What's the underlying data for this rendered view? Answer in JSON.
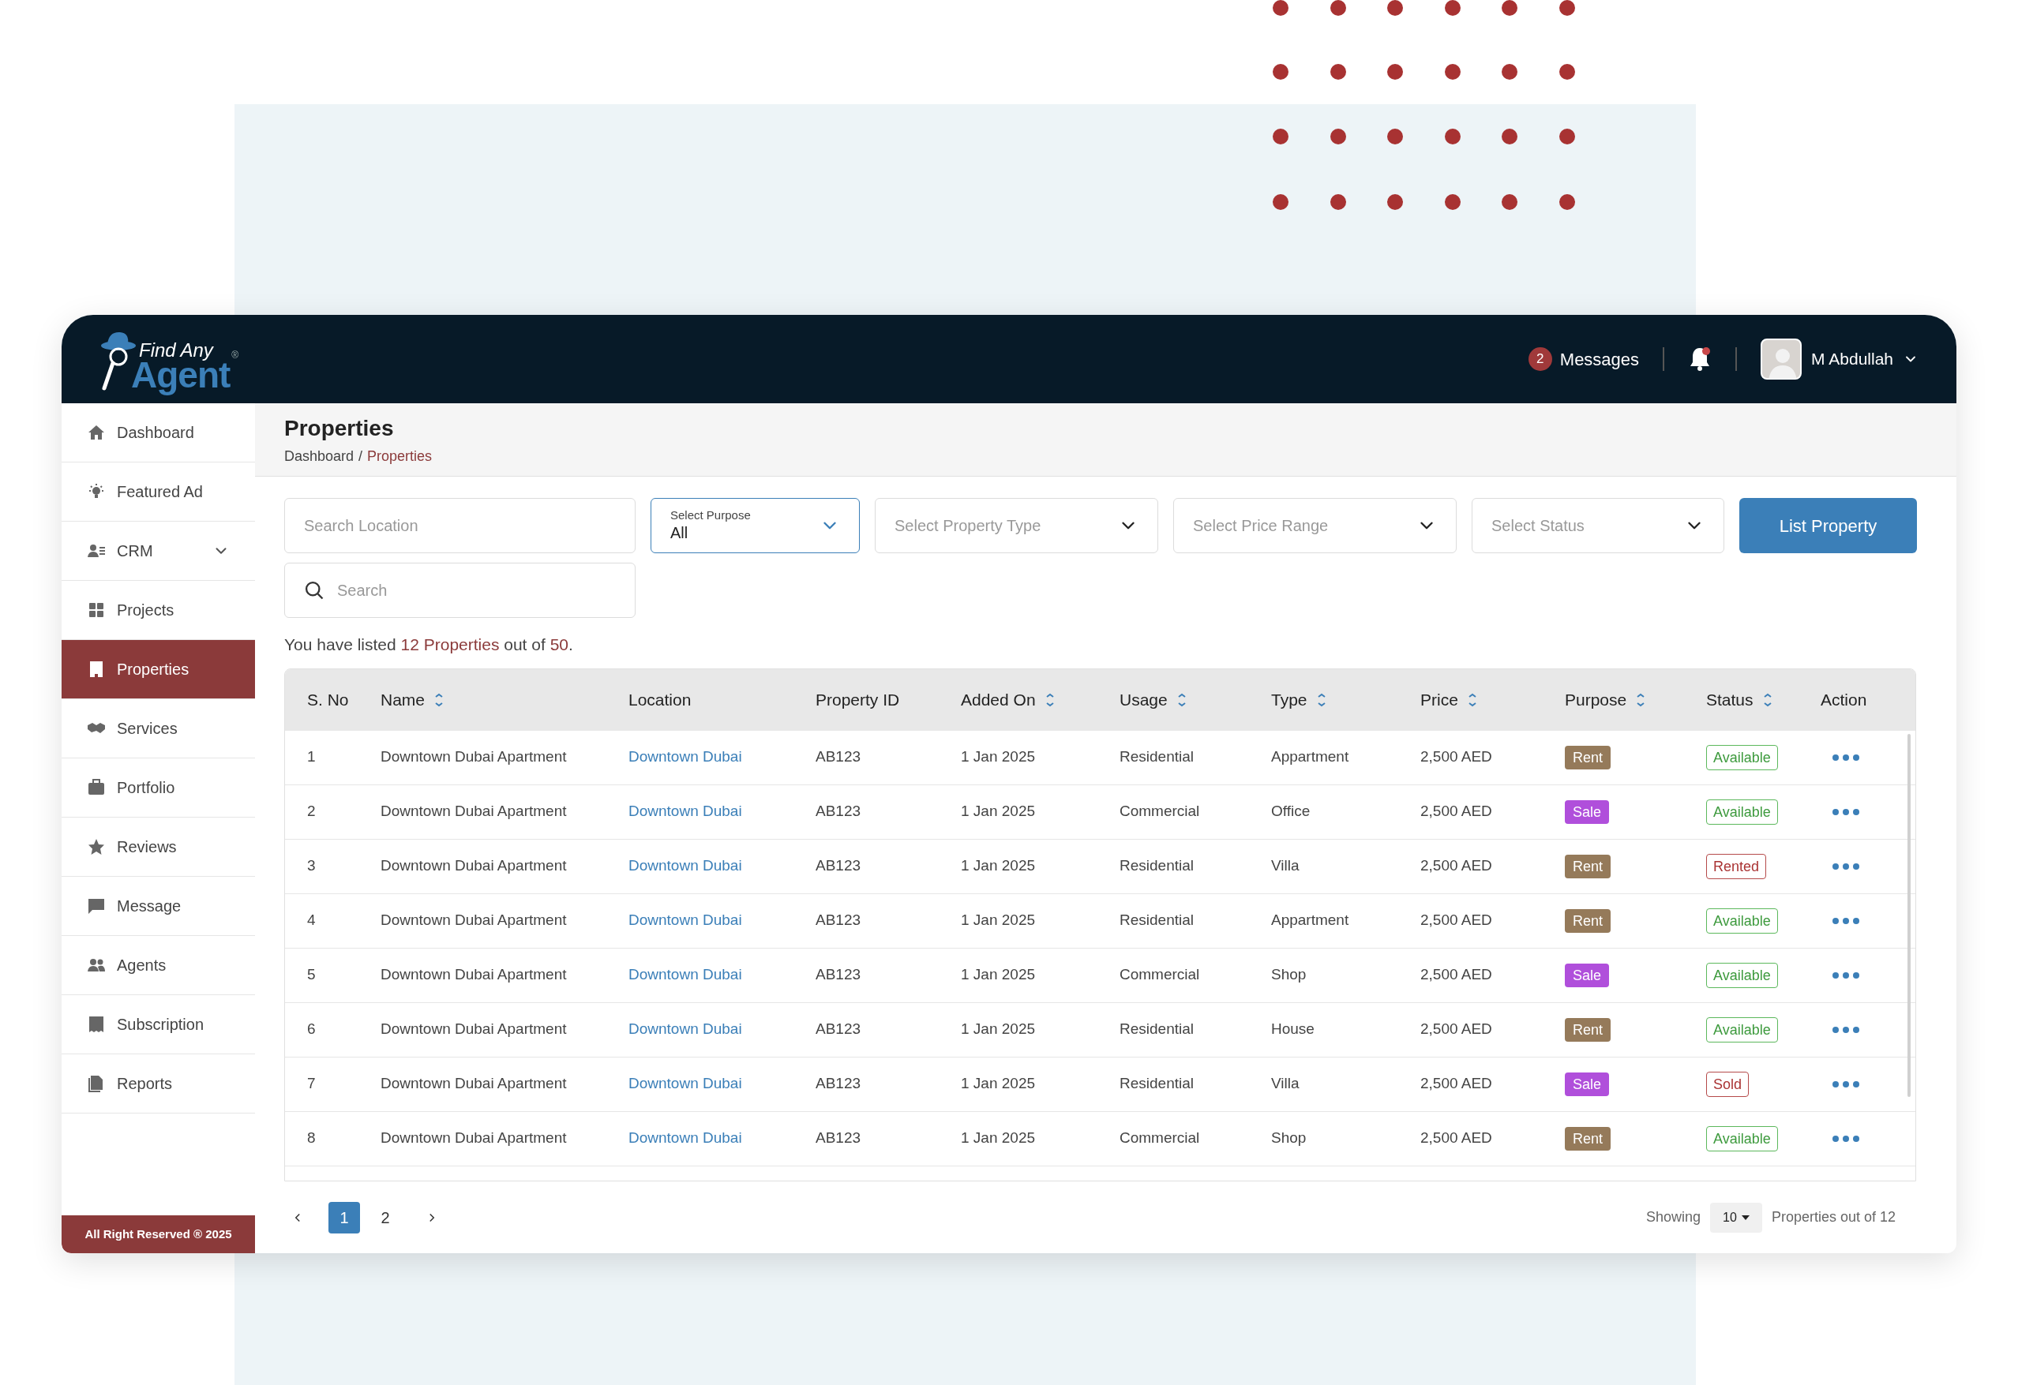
{
  "logo": {
    "line1": "Find Any",
    "line2": "Agent",
    "mark": "®"
  },
  "header": {
    "messages_count": "2",
    "messages_label": "Messages",
    "notification_dot": true,
    "user_name": "M Abdullah"
  },
  "sidebar": {
    "items": [
      {
        "label": "Dashboard",
        "kind": "link",
        "selected": false
      },
      {
        "label": "Featured Ad",
        "kind": "link",
        "selected": false
      },
      {
        "label": "CRM",
        "kind": "group",
        "selected": false
      },
      {
        "label": "Projects",
        "kind": "link",
        "selected": false
      },
      {
        "label": "Properties",
        "kind": "link",
        "selected": true
      },
      {
        "label": "Services",
        "kind": "link",
        "selected": false
      },
      {
        "label": "Portfolio",
        "kind": "link",
        "selected": false
      },
      {
        "label": "Reviews",
        "kind": "link",
        "selected": false
      },
      {
        "label": "Message",
        "kind": "link",
        "selected": false
      },
      {
        "label": "Agents",
        "kind": "link",
        "selected": false
      },
      {
        "label": "Subscription",
        "kind": "link",
        "selected": false
      },
      {
        "label": "Reports",
        "kind": "link",
        "selected": false
      }
    ],
    "footer": "All Right Reserved ® 2025"
  },
  "page": {
    "title": "Properties",
    "breadcrumb": [
      {
        "label": "Dashboard",
        "selected": false
      },
      {
        "label": "Properties",
        "selected": true
      }
    ],
    "breadcrumb_separator": "/"
  },
  "filters": [
    {
      "kind": "text",
      "placeholder": "Search Location",
      "focused": false
    },
    {
      "kind": "select",
      "label": "Select Purpose",
      "value": "All",
      "focused": true
    },
    {
      "kind": "select",
      "placeholder": "Select Property Type",
      "focused": false
    },
    {
      "kind": "select",
      "placeholder": "Select Price Range",
      "focused": false
    },
    {
      "kind": "select",
      "placeholder": "Select Status",
      "focused": false
    }
  ],
  "list_button": "List Property",
  "search": {
    "placeholder": "Search"
  },
  "summary": {
    "prefix": "You have listed ",
    "count": "12 Properties",
    "middle": " out of ",
    "total": "50",
    "suffix": "."
  },
  "table": {
    "columns": [
      {
        "label": "S. No",
        "sortable": false
      },
      {
        "label": "Name",
        "sortable": true
      },
      {
        "label": "Location",
        "sortable": false
      },
      {
        "label": "Property ID",
        "sortable": false
      },
      {
        "label": "Added On",
        "sortable": true
      },
      {
        "label": "Usage",
        "sortable": true
      },
      {
        "label": "Type",
        "sortable": true
      },
      {
        "label": "Price",
        "sortable": true
      },
      {
        "label": "Purpose",
        "sortable": true
      },
      {
        "label": "Status",
        "sortable": true
      },
      {
        "label": "Action",
        "sortable": false
      }
    ],
    "rows": [
      {
        "no": "1",
        "name": "Downtown Dubai Apartment",
        "location": "Downtown Dubai",
        "id": "AB123",
        "added": "1 Jan 2025",
        "usage": "Residential",
        "type": "Appartment",
        "price": "2,500 AED",
        "purpose": {
          "text": "Rent",
          "kind": "rent"
        },
        "status": {
          "text": "Available",
          "kind": "available"
        }
      },
      {
        "no": "2",
        "name": "Downtown Dubai Apartment",
        "location": "Downtown Dubai",
        "id": "AB123",
        "added": "1 Jan 2025",
        "usage": "Commercial",
        "type": "Office",
        "price": "2,500 AED",
        "purpose": {
          "text": "Sale",
          "kind": "sale"
        },
        "status": {
          "text": "Available",
          "kind": "available"
        }
      },
      {
        "no": "3",
        "name": "Downtown Dubai Apartment",
        "location": "Downtown Dubai",
        "id": "AB123",
        "added": "1 Jan 2025",
        "usage": "Residential",
        "type": "Villa",
        "price": "2,500 AED",
        "purpose": {
          "text": "Rent",
          "kind": "rent"
        },
        "status": {
          "text": "Rented",
          "kind": "rented"
        }
      },
      {
        "no": "4",
        "name": "Downtown Dubai Apartment",
        "location": "Downtown Dubai",
        "id": "AB123",
        "added": "1 Jan 2025",
        "usage": "Residential",
        "type": "Appartment",
        "price": "2,500 AED",
        "purpose": {
          "text": "Rent",
          "kind": "rent"
        },
        "status": {
          "text": "Available",
          "kind": "available"
        }
      },
      {
        "no": "5",
        "name": "Downtown Dubai Apartment",
        "location": "Downtown Dubai",
        "id": "AB123",
        "added": "1 Jan 2025",
        "usage": "Commercial",
        "type": "Shop",
        "price": "2,500 AED",
        "purpose": {
          "text": "Sale",
          "kind": "sale"
        },
        "status": {
          "text": "Available",
          "kind": "available"
        }
      },
      {
        "no": "6",
        "name": "Downtown Dubai Apartment",
        "location": "Downtown Dubai",
        "id": "AB123",
        "added": "1 Jan 2025",
        "usage": "Residential",
        "type": "House",
        "price": "2,500 AED",
        "purpose": {
          "text": "Rent",
          "kind": "rent"
        },
        "status": {
          "text": "Available",
          "kind": "available"
        }
      },
      {
        "no": "7",
        "name": "Downtown Dubai Apartment",
        "location": "Downtown Dubai",
        "id": "AB123",
        "added": "1 Jan 2025",
        "usage": "Residential",
        "type": "Villa",
        "price": "2,500 AED",
        "purpose": {
          "text": "Sale",
          "kind": "sale"
        },
        "status": {
          "text": "Sold",
          "kind": "sold"
        }
      },
      {
        "no": "8",
        "name": "Downtown Dubai Apartment",
        "location": "Downtown Dubai",
        "id": "AB123",
        "added": "1 Jan 2025",
        "usage": "Commercial",
        "type": "Shop",
        "price": "2,500 AED",
        "purpose": {
          "text": "Rent",
          "kind": "rent"
        },
        "status": {
          "text": "Available",
          "kind": "available"
        }
      }
    ]
  },
  "pagination": {
    "pages": [
      {
        "label": "1",
        "selected": true
      },
      {
        "label": "2",
        "selected": false
      }
    ],
    "showing_label": "Showing",
    "page_size": "10",
    "total_label": "Properties out of 12"
  }
}
